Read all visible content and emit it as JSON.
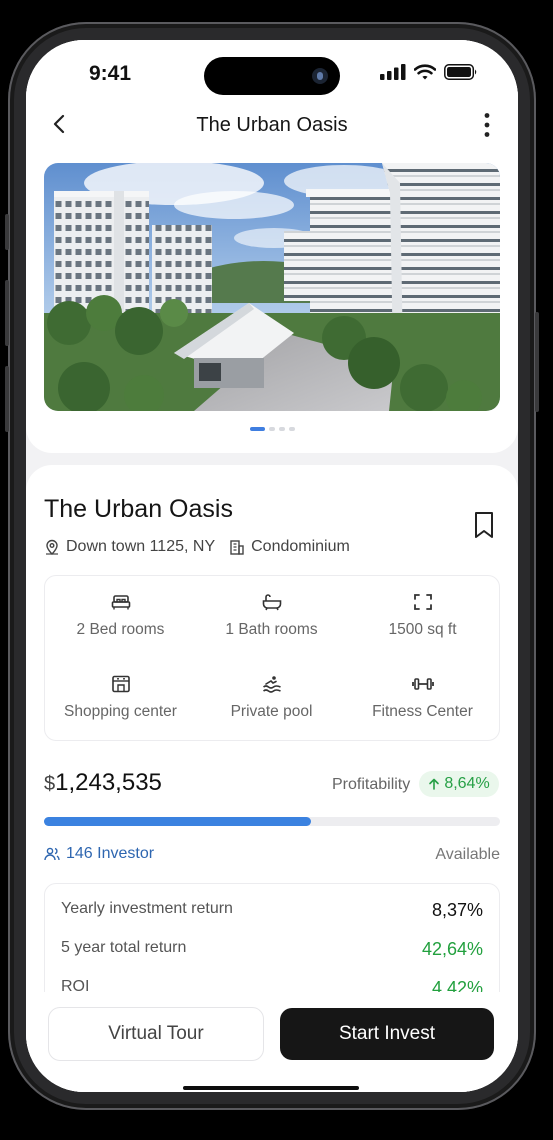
{
  "status_bar": {
    "time": "9:41"
  },
  "header": {
    "title": "The Urban Oasis"
  },
  "gallery": {
    "slides": 4,
    "active_index": 0
  },
  "property": {
    "name": "The Urban Oasis",
    "location": "Down town 1125, NY",
    "type": "Condominium"
  },
  "features": [
    {
      "icon": "bed-icon",
      "label": "2 Bed rooms"
    },
    {
      "icon": "bathtub-icon",
      "label": "1 Bath rooms"
    },
    {
      "icon": "area-frame-icon",
      "label": "1500 sq ft"
    },
    {
      "icon": "shop-icon",
      "label": "Shopping center"
    },
    {
      "icon": "pool-icon",
      "label": "Private pool"
    },
    {
      "icon": "dumbbell-icon",
      "label": "Fitness Center"
    }
  ],
  "investment": {
    "currency": "$",
    "amount": "1,243,535",
    "profitability_label": "Profitability",
    "profitability_value": "8,64%",
    "funded_fraction": 0.585,
    "investors": "146 Investor",
    "availability": "Available"
  },
  "returns": [
    {
      "label": "Yearly investment return",
      "value": "8,37%"
    },
    {
      "label": "5 year total return",
      "value": "42,64%"
    },
    {
      "label": "ROI",
      "value": "4.42%"
    }
  ],
  "actions": {
    "virtual_tour": "Virtual Tour",
    "start_invest": "Start Invest"
  },
  "colors": {
    "accent": "#3b82e0",
    "positive": "#22a03e",
    "primary_button": "#161616"
  }
}
